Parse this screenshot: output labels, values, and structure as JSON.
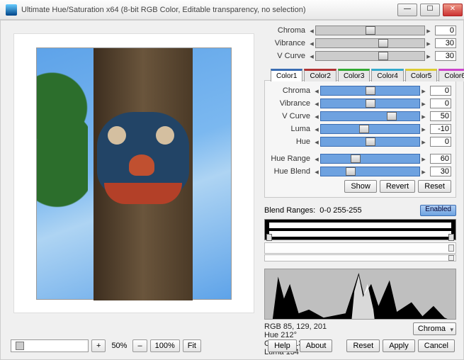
{
  "title": "Ultimate Hue/Saturation x64  (8-bit RGB Color, Editable transparency, no selection)",
  "global_sliders": [
    {
      "label": "Chroma",
      "value": "0",
      "pos": 50
    },
    {
      "label": "Vibrance",
      "value": "30",
      "pos": 62
    },
    {
      "label": "V Curve",
      "value": "30",
      "pos": 62
    }
  ],
  "tabs": [
    {
      "label": "Color1",
      "color": "#3a6db3",
      "active": true
    },
    {
      "label": "Color2",
      "color": "#b03333"
    },
    {
      "label": "Color3",
      "color": "#33aa33"
    },
    {
      "label": "Color4",
      "color": "#33aacc"
    },
    {
      "label": "Color5",
      "color": "#ddcc33"
    },
    {
      "label": "Color6",
      "color": "#cc44cc"
    }
  ],
  "color_sliders": [
    {
      "label": "Chroma",
      "value": "0",
      "pos": 50
    },
    {
      "label": "Vibrance",
      "value": "0",
      "pos": 50
    },
    {
      "label": "V Curve",
      "value": "50",
      "pos": 72
    },
    {
      "label": "Luma",
      "value": "-10",
      "pos": 44
    },
    {
      "label": "Hue",
      "value": "0",
      "pos": 50
    }
  ],
  "hue_sliders": [
    {
      "label": "Hue Range",
      "value": "60",
      "pos": 35
    },
    {
      "label": "Hue Blend",
      "value": "30",
      "pos": 30
    }
  ],
  "panel_buttons": {
    "show": "Show",
    "revert": "Revert",
    "reset": "Reset"
  },
  "blend": {
    "label": "Blend Ranges:",
    "range": "0-0  255-255",
    "enabled": "Enabled"
  },
  "info": {
    "rgb": "RGB 85, 129, 201",
    "hue": "Hue 212°",
    "chroma": "Chroma 136",
    "luma": "Luma 134"
  },
  "histo_select": "Chroma",
  "zoom": {
    "plus": "+",
    "pct": "50%",
    "minus": "–",
    "hundred": "100%",
    "fit": "Fit"
  },
  "footer": {
    "help": "Help",
    "about": "About",
    "reset": "Reset",
    "apply": "Apply",
    "cancel": "Cancel"
  }
}
